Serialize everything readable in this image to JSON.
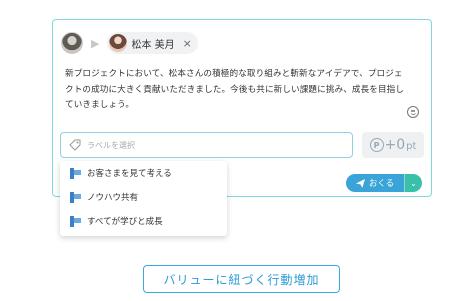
{
  "recipient": {
    "name": "松本 美月",
    "close_symbol": "×"
  },
  "message": {
    "line1": "新プロジェクトにおいて、松本さんの積極的な取り組みと斬新なアイデアで、プロジェ",
    "line2": "クトの成功に大きく貢献いただきました。今後も共に新しい課題に挑み、成長を目指し",
    "line3": "ていきましょう。"
  },
  "label_field": {
    "placeholder": "ラベルを選択"
  },
  "points": {
    "icon_letter": "P",
    "value": "+0",
    "unit": "pt"
  },
  "send": {
    "label": "おくる",
    "menu_symbol": "⌄"
  },
  "dropdown": {
    "items": [
      {
        "label": "お客さまを見て考える"
      },
      {
        "label": "ノウハウ共有"
      },
      {
        "label": "すべてが学びと成長"
      }
    ]
  },
  "footer": {
    "label": "バリューに紐づく行動増加"
  },
  "colors": {
    "card_border": "#7fd7e0",
    "accent_blue": "#3aa4d8",
    "accent_green": "#38c0a8",
    "value_icon_blue": "#3b7fc4"
  },
  "icons": {
    "sender_avatar": "sender-avatar",
    "arrow": "arrow-right-icon",
    "tag": "tag-icon",
    "emoji": "smiley-icon",
    "points": "points-p-icon",
    "send": "paper-plane-icon",
    "value": "value-flag-icon"
  }
}
